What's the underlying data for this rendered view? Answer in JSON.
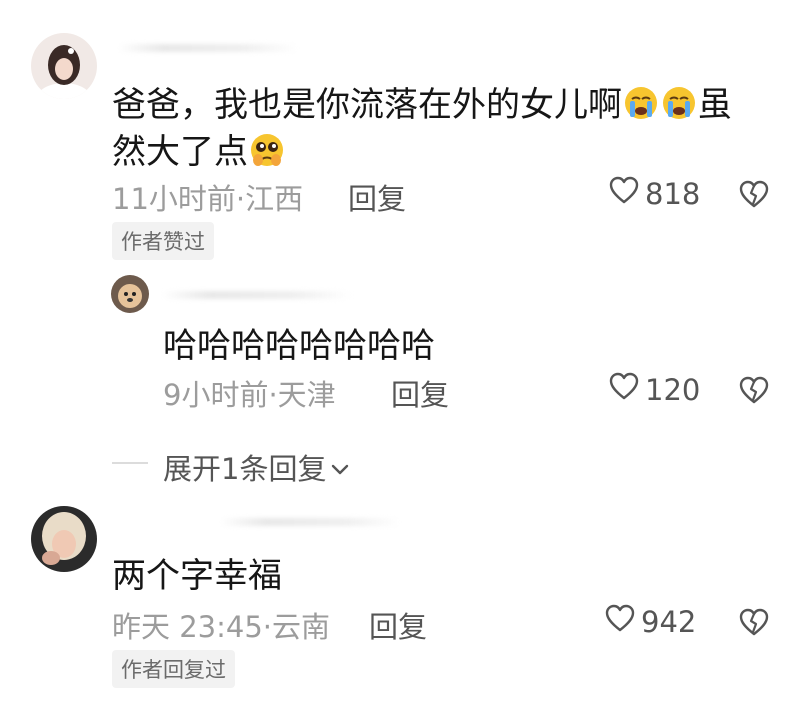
{
  "comments": [
    {
      "text_line1": "爸爸，我也是你流落在外的女儿啊",
      "text_line2": "然大了点",
      "text_line1_tail": "虽",
      "meta": "11小时前·江西",
      "reply_label": "回复",
      "likes": "818",
      "tag": "作者赞过",
      "emojis": [
        "loudly-crying-face",
        "loudly-crying-face",
        "pleading-face"
      ]
    },
    {
      "text": "哈哈哈哈哈哈哈哈",
      "meta": "9小时前·天津",
      "reply_label": "回复",
      "likes": "120"
    },
    {
      "text": "两个字幸福",
      "meta": "昨天 23:45·云南",
      "reply_label": "回复",
      "likes": "942",
      "tag": "作者回复过"
    }
  ],
  "expand_replies": "展开1条回复",
  "colors": {
    "text": "#161616",
    "meta": "#9c9c9c",
    "action": "#555555",
    "tag_bg": "#f2f2f2"
  }
}
